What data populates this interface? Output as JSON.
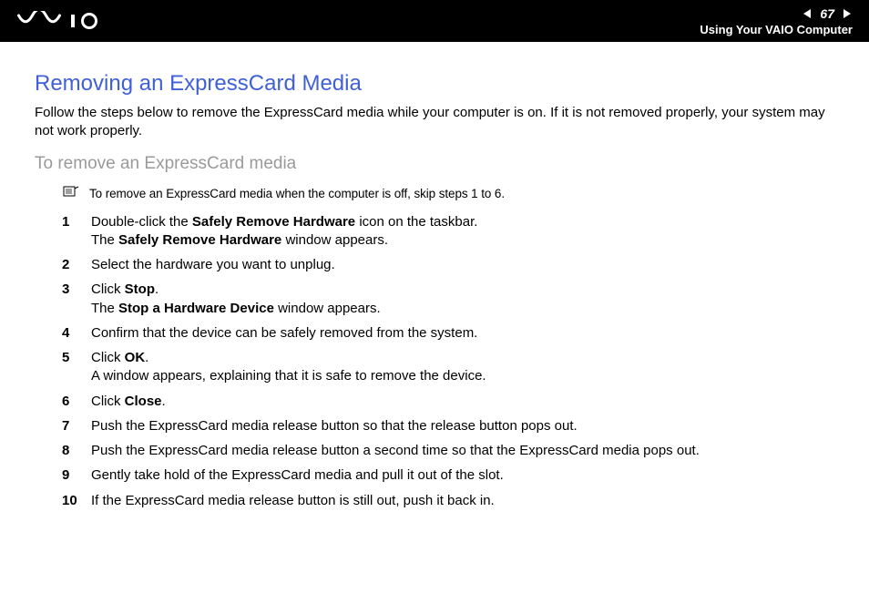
{
  "header": {
    "page_number": "67",
    "section": "Using Your VAIO Computer"
  },
  "content": {
    "heading": "Removing an ExpressCard Media",
    "intro": "Follow the steps below to remove the ExpressCard media while your computer is on. If it is not removed properly, your system may not work properly.",
    "subheading": "To remove an ExpressCard media",
    "note": "To remove an ExpressCard media when the computer is off, skip steps 1 to 6.",
    "steps": [
      {
        "n": "1",
        "pre": "Double-click the ",
        "b1": "Safely Remove Hardware",
        "mid": " icon on the taskbar.",
        "br": true,
        "pre2": "The ",
        "b2": "Safely Remove Hardware",
        "post2": " window appears."
      },
      {
        "n": "2",
        "pre": "Select the hardware you want to unplug."
      },
      {
        "n": "3",
        "pre": "Click ",
        "b1": "Stop",
        "mid": ".",
        "br": true,
        "pre2": "The ",
        "b2": "Stop a Hardware Device",
        "post2": " window appears."
      },
      {
        "n": "4",
        "pre": "Confirm that the device can be safely removed from the system."
      },
      {
        "n": "5",
        "pre": "Click ",
        "b1": "OK",
        "mid": ".",
        "br": true,
        "pre2": "A window appears, explaining that it is safe to remove the device."
      },
      {
        "n": "6",
        "pre": "Click ",
        "b1": "Close",
        "mid": "."
      },
      {
        "n": "7",
        "pre": "Push the ExpressCard media release button so that the release button pops out."
      },
      {
        "n": "8",
        "pre": "Push the ExpressCard media release button a second time so that the ExpressCard media pops out."
      },
      {
        "n": "9",
        "pre": "Gently take hold of the ExpressCard media and pull it out of the slot."
      },
      {
        "n": "10",
        "pre": "If the ExpressCard media release button is still out, push it back in."
      }
    ]
  }
}
